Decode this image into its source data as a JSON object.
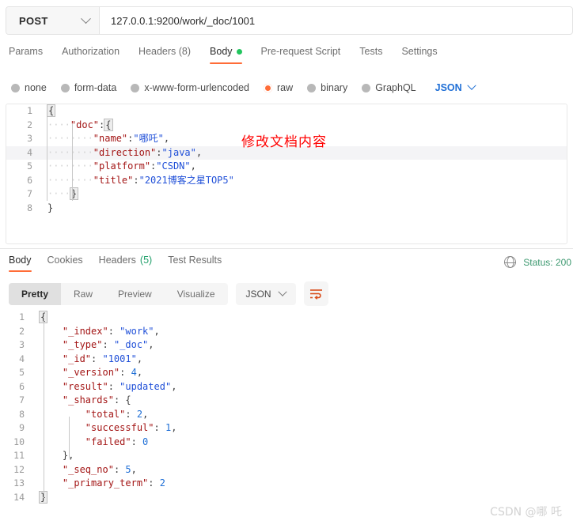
{
  "request_bar": {
    "method": "POST",
    "method_chevron_icon": "chevron-down-icon",
    "url": "127.0.0.1:9200/work/_doc/1001"
  },
  "request_tabs": [
    {
      "label": "Params",
      "active": false
    },
    {
      "label": "Authorization",
      "active": false
    },
    {
      "label": "Headers (8)",
      "active": false
    },
    {
      "label": "Body",
      "active": true,
      "dot": "green"
    },
    {
      "label": "Pre-request Script",
      "active": false
    },
    {
      "label": "Tests",
      "active": false
    },
    {
      "label": "Settings",
      "active": false
    }
  ],
  "body_types": {
    "options": [
      {
        "label": "none",
        "checked": false
      },
      {
        "label": "form-data",
        "checked": false
      },
      {
        "label": "x-www-form-urlencoded",
        "checked": false
      },
      {
        "label": "raw",
        "checked": true
      },
      {
        "label": "binary",
        "checked": false
      },
      {
        "label": "GraphQL",
        "checked": false
      }
    ],
    "format_label": "JSON",
    "format_chevron_icon": "chevron-down-icon"
  },
  "request_body": {
    "lines": [
      {
        "n": "1",
        "text": "{"
      },
      {
        "n": "2",
        "text": "    \"doc\":{"
      },
      {
        "n": "3",
        "text": "        \"name\":\"哪吒\","
      },
      {
        "n": "4",
        "text": "        \"direction\":\"java\","
      },
      {
        "n": "5",
        "text": "        \"platform\":\"CSDN\","
      },
      {
        "n": "6",
        "text": "        \"title\":\"2021博客之星TOP5\""
      },
      {
        "n": "7",
        "text": "    }"
      },
      {
        "n": "8",
        "text": "}"
      }
    ]
  },
  "annotation": {
    "text": "修改文档内容",
    "color": "#ff0000"
  },
  "response_tabs": [
    {
      "label": "Body",
      "active": true
    },
    {
      "label": "Cookies",
      "active": false
    },
    {
      "label": "Headers",
      "count": "(5)",
      "active": false
    },
    {
      "label": "Test Results",
      "active": false
    }
  ],
  "response_status": {
    "globe_icon": "globe-icon",
    "text": "Status: 200"
  },
  "format_bar": {
    "segments": [
      {
        "label": "Pretty",
        "active": true
      },
      {
        "label": "Raw",
        "active": false
      },
      {
        "label": "Preview",
        "active": false
      },
      {
        "label": "Visualize",
        "active": false
      }
    ],
    "format_label": "JSON",
    "format_chevron_icon": "chevron-down-icon",
    "wrap_icon": "wrap-lines-icon"
  },
  "response_body": {
    "lines": [
      {
        "n": "1",
        "text": "{"
      },
      {
        "n": "2",
        "text": "    \"_index\": \"work\","
      },
      {
        "n": "3",
        "text": "    \"_type\": \"_doc\","
      },
      {
        "n": "4",
        "text": "    \"_id\": \"1001\","
      },
      {
        "n": "5",
        "text": "    \"_version\": 4,"
      },
      {
        "n": "6",
        "text": "    \"result\": \"updated\","
      },
      {
        "n": "7",
        "text": "    \"_shards\": {"
      },
      {
        "n": "8",
        "text": "        \"total\": 2,"
      },
      {
        "n": "9",
        "text": "        \"successful\": 1,"
      },
      {
        "n": "10",
        "text": "        \"failed\": 0"
      },
      {
        "n": "11",
        "text": "    },"
      },
      {
        "n": "12",
        "text": "    \"_seq_no\": 5,"
      },
      {
        "n": "13",
        "text": "    \"_primary_term\": 2"
      },
      {
        "n": "14",
        "text": "}"
      }
    ]
  },
  "watermark": {
    "text": "CSDN @哪 吒"
  }
}
